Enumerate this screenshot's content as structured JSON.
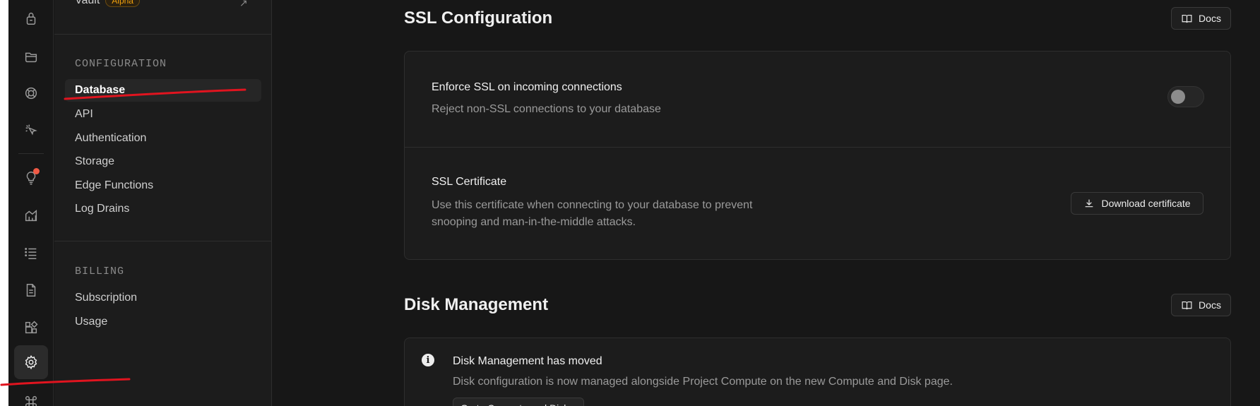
{
  "colors": {
    "background": "#171717",
    "panel": "#1c1c1c",
    "alpha_badge": "#f1a10d",
    "annotation": "#e0141f",
    "notification": "#f05a45"
  },
  "iconbar": {
    "items": [
      {
        "name": "lock-icon"
      },
      {
        "name": "folder-icon"
      },
      {
        "name": "realtime-icon"
      },
      {
        "name": "pointer-icon"
      },
      {
        "name": "lightbulb-icon"
      },
      {
        "name": "reports-icon"
      },
      {
        "name": "list-icon"
      },
      {
        "name": "document-icon"
      },
      {
        "name": "integrations-icon"
      },
      {
        "name": "gear-icon"
      },
      {
        "name": "command-icon"
      }
    ]
  },
  "menu": {
    "top_item": {
      "label": "Vault",
      "badge": "Alpha"
    },
    "configuration": {
      "title": "CONFIGURATION",
      "items": [
        "Database",
        "API",
        "Authentication",
        "Storage",
        "Edge Functions",
        "Log Drains"
      ]
    },
    "billing": {
      "title": "BILLING",
      "items": [
        "Subscription",
        "Usage"
      ]
    }
  },
  "ssl": {
    "heading": "SSL Configuration",
    "docs_label": "Docs",
    "enforce": {
      "title": "Enforce SSL on incoming connections",
      "description": "Reject non-SSL connections to your database",
      "enabled": false
    },
    "certificate": {
      "title": "SSL Certificate",
      "description": "Use this certificate when connecting to your database to prevent snooping and man-in-the-middle attacks.",
      "button_label": "Download certificate"
    }
  },
  "disk": {
    "heading": "Disk Management",
    "docs_label": "Docs",
    "notice": {
      "title": "Disk Management has moved",
      "description": "Disk configuration is now managed alongside Project Compute on the new Compute and Disk page.",
      "button_label": "Go to Compute and Disk"
    }
  }
}
